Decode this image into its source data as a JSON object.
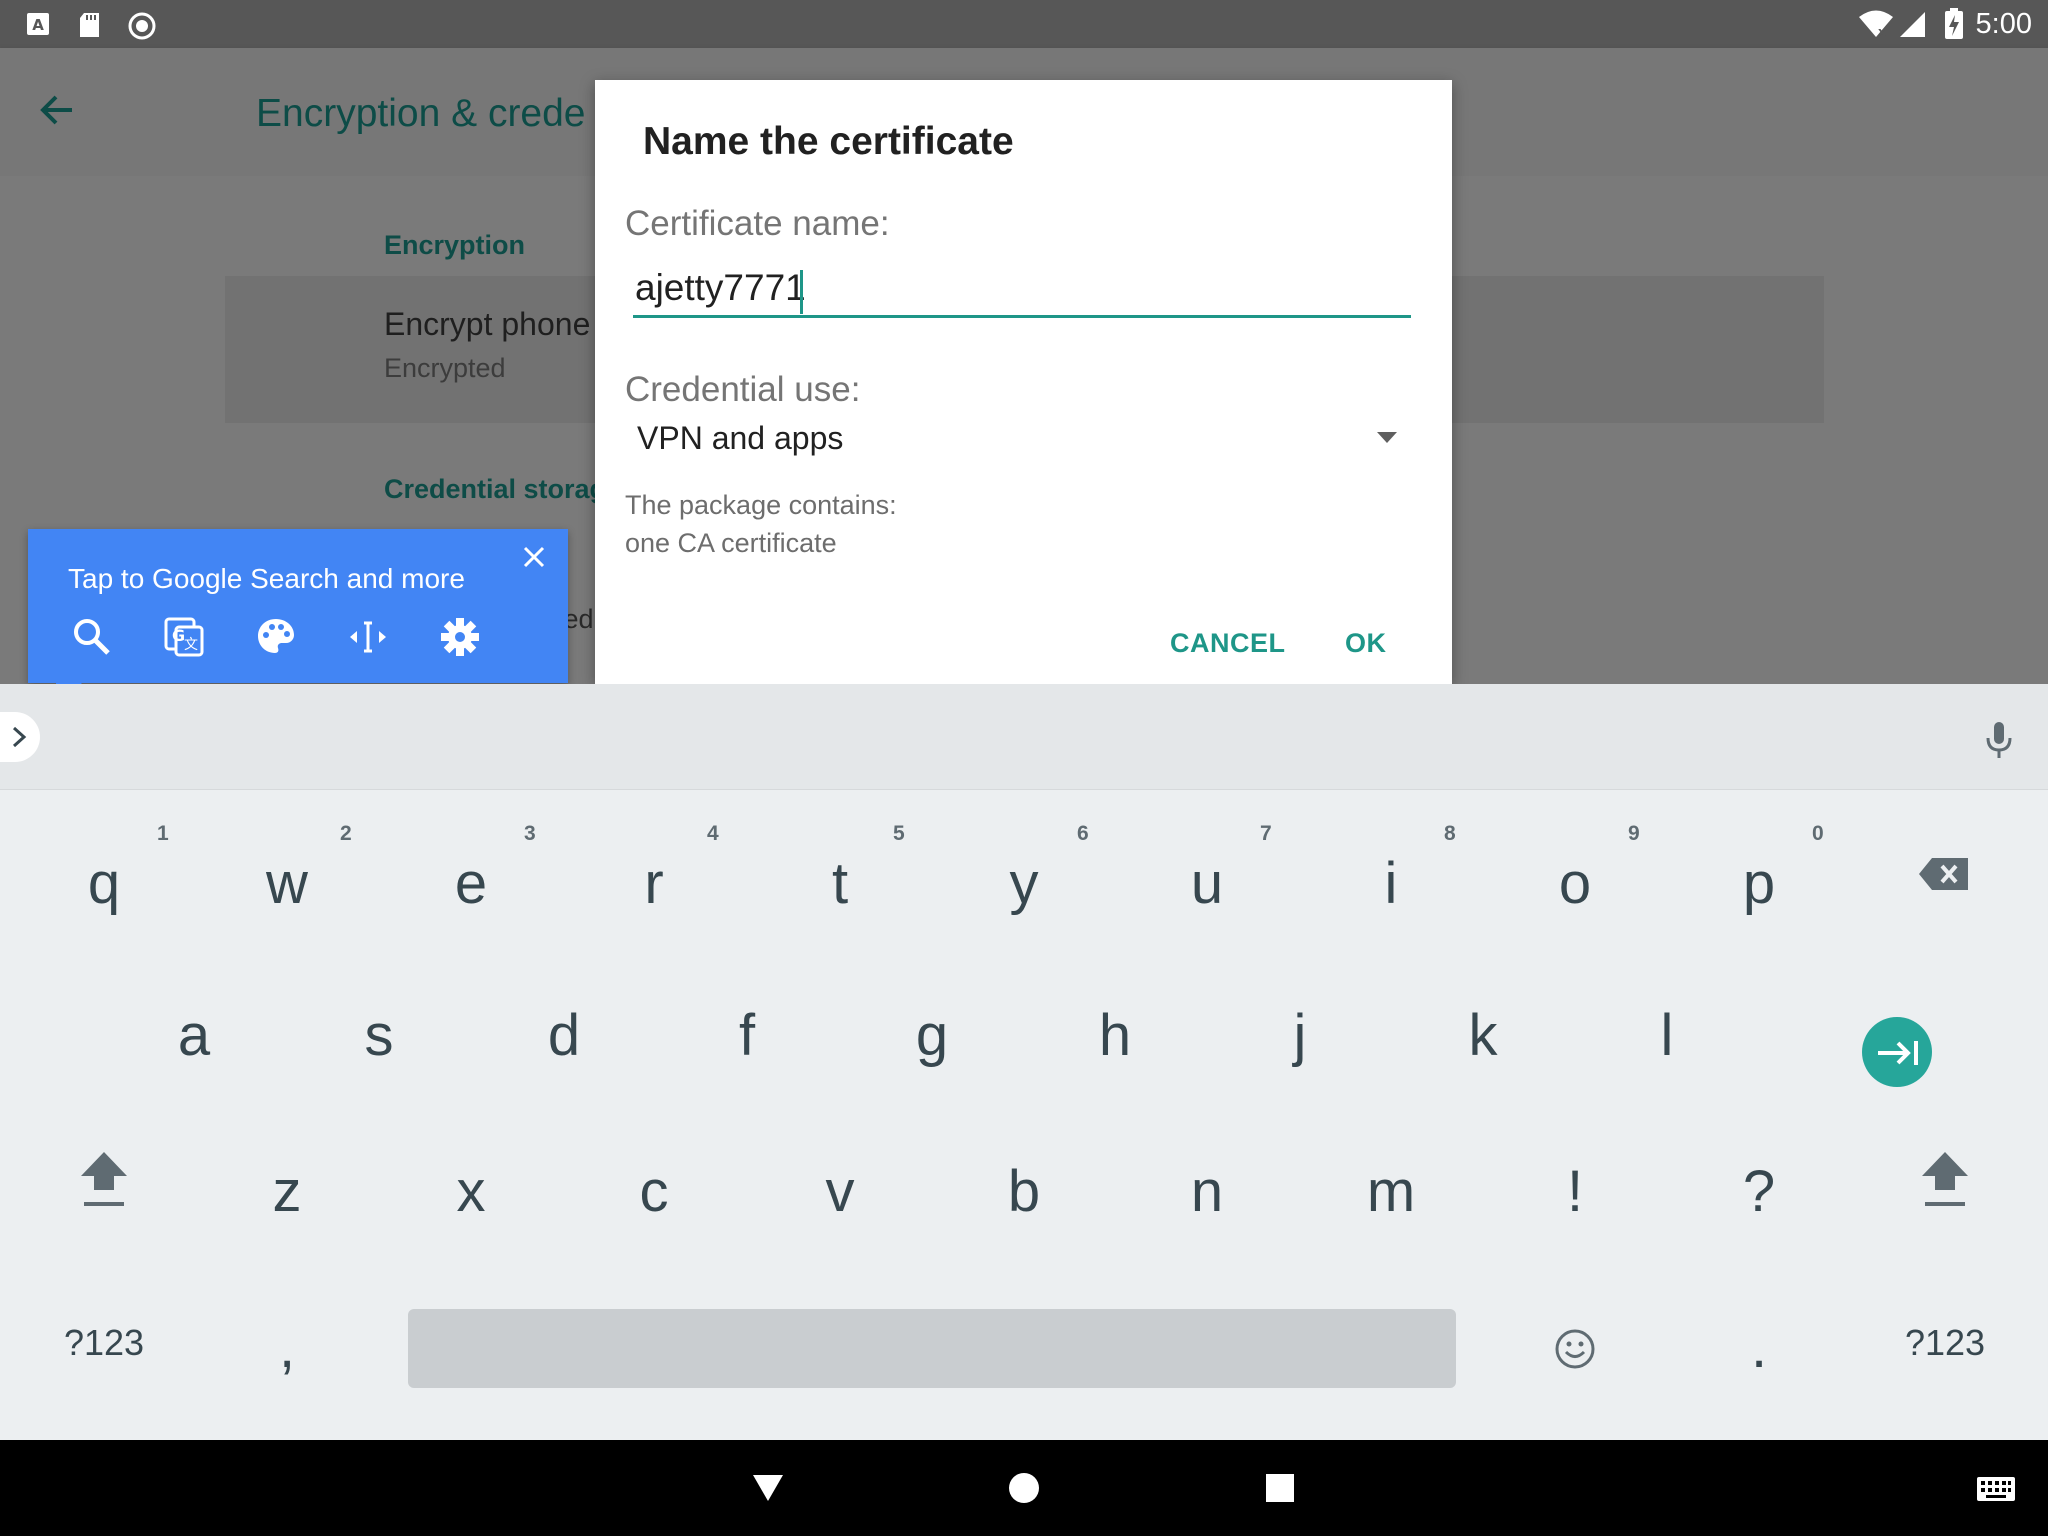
{
  "status_bar": {
    "time": "5:00"
  },
  "settings": {
    "title": "Encryption & crede",
    "encryption_header": "Encryption",
    "encrypt_phone_title": "Encrypt phone",
    "encrypt_phone_status": "Encrypted",
    "credential_storage_header": "Credential storag",
    "partial_text": "ted"
  },
  "dialog": {
    "title": "Name the certificate",
    "certificate_name_label": "Certificate name:",
    "certificate_name_value": "ajetty7771",
    "credential_use_label": "Credential use:",
    "credential_use_value": "VPN and apps",
    "package_line1": "The package contains:",
    "package_line2": "one CA certificate",
    "cancel_label": "CANCEL",
    "ok_label": "OK"
  },
  "tooltip": {
    "text": "Tap to Google Search and more"
  },
  "keyboard": {
    "row1": [
      {
        "key": "q",
        "hint": "1"
      },
      {
        "key": "w",
        "hint": "2"
      },
      {
        "key": "e",
        "hint": "3"
      },
      {
        "key": "r",
        "hint": "4"
      },
      {
        "key": "t",
        "hint": "5"
      },
      {
        "key": "y",
        "hint": "6"
      },
      {
        "key": "u",
        "hint": "7"
      },
      {
        "key": "i",
        "hint": "8"
      },
      {
        "key": "o",
        "hint": "9"
      },
      {
        "key": "p",
        "hint": "0"
      }
    ],
    "row2": [
      "a",
      "s",
      "d",
      "f",
      "g",
      "h",
      "j",
      "k",
      "l"
    ],
    "row3": [
      "z",
      "x",
      "c",
      "v",
      "b",
      "n",
      "m",
      "!",
      "?"
    ],
    "symbols_left": "?123",
    "comma": ",",
    "period": ".",
    "symbols_right": "?123"
  },
  "colors": {
    "accent": "#1e9688",
    "tooltip": "#4285f4",
    "enter_key": "#26a69a"
  }
}
